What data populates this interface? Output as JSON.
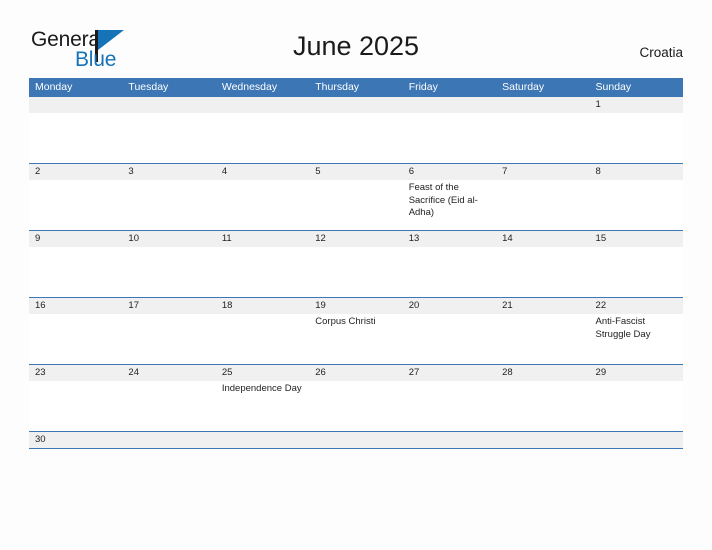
{
  "branding": {
    "logo_primary": "General",
    "logo_secondary": "Blue",
    "flag_icon": "flag-triangle-icon"
  },
  "header": {
    "title": "June 2025",
    "country": "Croatia"
  },
  "colors": {
    "header_blue": "#3c76b5",
    "logo_blue": "#1673b8",
    "number_band": "#f0f0f0",
    "page_background": "#fdfdfd",
    "text": "#222222"
  },
  "calendar": {
    "month": "June",
    "year": "2025",
    "week_start": "Monday",
    "day_headers": [
      "Monday",
      "Tuesday",
      "Wednesday",
      "Thursday",
      "Friday",
      "Saturday",
      "Sunday"
    ],
    "weeks": [
      {
        "short": false,
        "days": [
          {
            "num": "",
            "events": []
          },
          {
            "num": "",
            "events": []
          },
          {
            "num": "",
            "events": []
          },
          {
            "num": "",
            "events": []
          },
          {
            "num": "",
            "events": []
          },
          {
            "num": "",
            "events": []
          },
          {
            "num": "1",
            "events": []
          }
        ]
      },
      {
        "short": false,
        "days": [
          {
            "num": "2",
            "events": []
          },
          {
            "num": "3",
            "events": []
          },
          {
            "num": "4",
            "events": []
          },
          {
            "num": "5",
            "events": []
          },
          {
            "num": "6",
            "events": [
              "Feast of the Sacrifice (Eid al-Adha)"
            ]
          },
          {
            "num": "7",
            "events": []
          },
          {
            "num": "8",
            "events": []
          }
        ]
      },
      {
        "short": false,
        "days": [
          {
            "num": "9",
            "events": []
          },
          {
            "num": "10",
            "events": []
          },
          {
            "num": "11",
            "events": []
          },
          {
            "num": "12",
            "events": []
          },
          {
            "num": "13",
            "events": []
          },
          {
            "num": "14",
            "events": []
          },
          {
            "num": "15",
            "events": []
          }
        ]
      },
      {
        "short": false,
        "days": [
          {
            "num": "16",
            "events": []
          },
          {
            "num": "17",
            "events": []
          },
          {
            "num": "18",
            "events": []
          },
          {
            "num": "19",
            "events": [
              "Corpus Christi"
            ]
          },
          {
            "num": "20",
            "events": []
          },
          {
            "num": "21",
            "events": []
          },
          {
            "num": "22",
            "events": [
              "Anti-Fascist Struggle Day"
            ]
          }
        ]
      },
      {
        "short": false,
        "days": [
          {
            "num": "23",
            "events": []
          },
          {
            "num": "24",
            "events": []
          },
          {
            "num": "25",
            "events": [
              "Independence Day"
            ]
          },
          {
            "num": "26",
            "events": []
          },
          {
            "num": "27",
            "events": []
          },
          {
            "num": "28",
            "events": []
          },
          {
            "num": "29",
            "events": []
          }
        ]
      },
      {
        "short": true,
        "days": [
          {
            "num": "30",
            "events": []
          },
          {
            "num": "",
            "events": []
          },
          {
            "num": "",
            "events": []
          },
          {
            "num": "",
            "events": []
          },
          {
            "num": "",
            "events": []
          },
          {
            "num": "",
            "events": []
          },
          {
            "num": "",
            "events": []
          }
        ]
      }
    ]
  }
}
